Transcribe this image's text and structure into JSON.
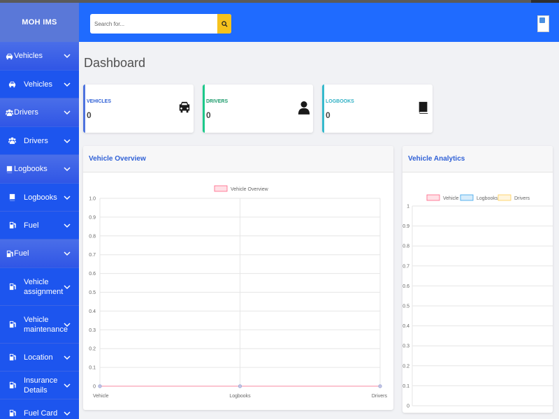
{
  "brand": "MOH IMS",
  "sidebar": {
    "items": [
      {
        "label": "Vehicles",
        "type": "group",
        "icon": "car-icon"
      },
      {
        "label": "Vehicles",
        "type": "link",
        "icon": "car-icon"
      },
      {
        "label": "Drivers",
        "type": "group",
        "icon": "users-icon"
      },
      {
        "label": "Drivers",
        "type": "link",
        "icon": "users-icon"
      },
      {
        "label": "Logbooks",
        "type": "group",
        "icon": "book-icon"
      },
      {
        "label": "Logbooks",
        "type": "link",
        "icon": "book-icon"
      },
      {
        "label": "Fuel",
        "type": "link",
        "icon": "gas-pump-icon"
      },
      {
        "label": "Fuel",
        "type": "group",
        "icon": "gas-pump-icon"
      },
      {
        "label": "Vehicle assignment",
        "type": "link",
        "icon": "gas-pump-icon"
      },
      {
        "label": "Vehicle maintenance",
        "type": "link",
        "icon": "gas-pump-icon"
      },
      {
        "label": "Location",
        "type": "link",
        "icon": "gas-pump-icon"
      },
      {
        "label": "Insurance Details",
        "type": "link",
        "icon": "gas-pump-icon"
      },
      {
        "label": "Fuel Card",
        "type": "link",
        "icon": "gas-pump-icon"
      }
    ]
  },
  "search": {
    "placeholder": "Search for..."
  },
  "page_title": "Dashboard",
  "stats": [
    {
      "label": "VEHICLES",
      "value": "0",
      "color": "#4e73df",
      "label_color": "#2f60d6",
      "icon": "car-icon"
    },
    {
      "label": "DRIVERS",
      "value": "0",
      "color": "#1cc88a",
      "label_color": "#1a9a6a",
      "icon": "user-icon"
    },
    {
      "label": "LOGBOOKS",
      "value": "0",
      "color": "#36b9cc",
      "label_color": "#2fb0c4",
      "icon": "book-icon"
    }
  ],
  "cards": {
    "overview_title": "Vehicle Overview",
    "analytics_title": "Vehicle Analytics"
  },
  "chart_data": [
    {
      "type": "line",
      "categories": [
        "Vehicle",
        "Logbooks",
        "Drivers"
      ],
      "series": [
        {
          "name": "Vehicle Overview",
          "values": [
            0,
            0,
            0
          ],
          "color": "#ff6384"
        }
      ],
      "ylim": [
        0,
        1
      ],
      "yticks": [
        "0",
        "0.1",
        "0.2",
        "0.3",
        "0.4",
        "0.5",
        "0.6",
        "0.7",
        "0.8",
        "0.9",
        "1.0"
      ],
      "grid": true,
      "legend": "top"
    },
    {
      "type": "bar",
      "categories": [],
      "series": [
        {
          "name": "Vehicle",
          "values": [],
          "color": "#ff6384"
        },
        {
          "name": "Logbooks",
          "values": [],
          "color": "#36a2eb"
        },
        {
          "name": "Drivers",
          "values": [],
          "color": "#ffcd56"
        }
      ],
      "ylim": [
        0,
        1
      ],
      "yticks": [
        "0",
        "0.1",
        "0.2",
        "0.3",
        "0.4",
        "0.5",
        "0.6",
        "0.7",
        "0.8",
        "0.9",
        "1"
      ],
      "grid": true,
      "legend": "top"
    }
  ]
}
